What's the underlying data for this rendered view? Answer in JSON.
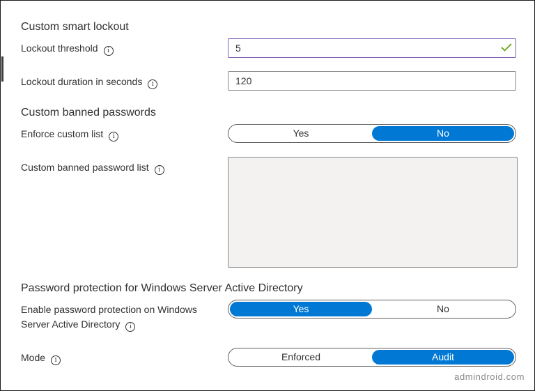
{
  "lockout": {
    "section_title": "Custom smart lockout",
    "threshold_label": "Lockout threshold",
    "threshold_value": "5",
    "duration_label": "Lockout duration in seconds",
    "duration_value": "120"
  },
  "banned": {
    "section_title": "Custom banned passwords",
    "enforce_label": "Enforce custom list",
    "enforce_options": [
      "Yes",
      "No"
    ],
    "enforce_selected": "No",
    "list_label": "Custom banned password list",
    "list_value": ""
  },
  "windows": {
    "section_title": "Password protection for Windows Server Active Directory",
    "enable_label_line1": "Enable password protection on Windows",
    "enable_label_line2": "Server Active Directory",
    "enable_options": [
      "Yes",
      "No"
    ],
    "enable_selected": "Yes",
    "mode_label": "Mode",
    "mode_options": [
      "Enforced",
      "Audit"
    ],
    "mode_selected": "Audit"
  },
  "icons": {
    "info": "info-icon",
    "valid": "checkmark-icon"
  },
  "colors": {
    "accent": "#0078d4",
    "focus_border": "#8764b8",
    "valid_check": "#57a300",
    "disabled_fill": "#f3f2f1"
  },
  "watermark": "admindroid.com"
}
